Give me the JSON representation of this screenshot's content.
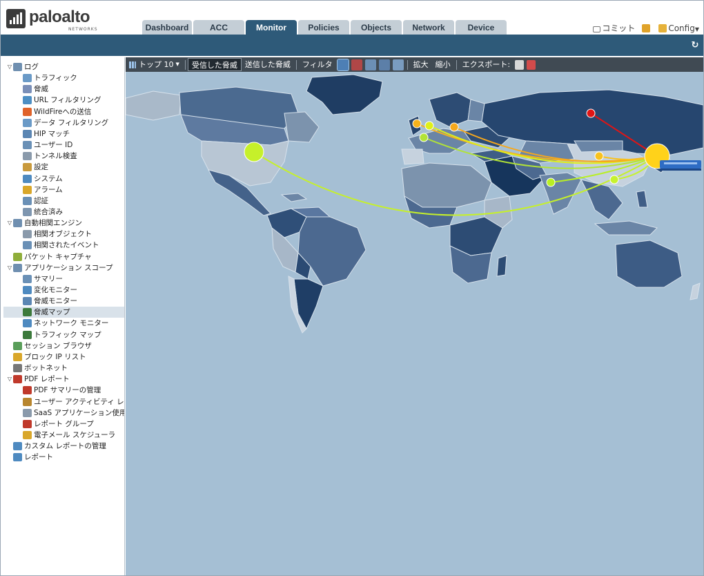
{
  "logo": {
    "word": "paloalto",
    "sub": "NETWORKS"
  },
  "tabs": [
    "Dashboard",
    "ACC",
    "Monitor",
    "Policies",
    "Objects",
    "Network",
    "Device"
  ],
  "active_tab": "Monitor",
  "header_right": {
    "commit": "コミット",
    "config": "Config"
  },
  "toolbar": {
    "top": "トップ 10",
    "received": "受信した脅威",
    "sent": "送信した脅威",
    "filter": "フィルタ",
    "zoom_in": "拡大",
    "zoom_out": "縮小",
    "export": "エクスポート:"
  },
  "sidebar": [
    {
      "label": "ログ",
      "level": 0,
      "expand": "▽",
      "icon": "logs-icon",
      "color": "#6f8fb0"
    },
    {
      "label": "トラフィック",
      "level": 1,
      "icon": "traffic-icon",
      "color": "#6a9ac7"
    },
    {
      "label": "脅威",
      "level": 1,
      "icon": "threat-icon",
      "color": "#7a8fb8"
    },
    {
      "label": "URL フィルタリング",
      "level": 1,
      "icon": "url-icon",
      "color": "#4d8fc4"
    },
    {
      "label": "WildFireへの送信",
      "level": 1,
      "icon": "wildfire-icon",
      "color": "#e0632a"
    },
    {
      "label": "データ フィルタリング",
      "level": 1,
      "icon": "data-filter-icon",
      "color": "#6a9ac7"
    },
    {
      "label": "HIP マッチ",
      "level": 1,
      "icon": "hip-icon",
      "color": "#5b86b3"
    },
    {
      "label": "ユーザー ID",
      "level": 1,
      "icon": "user-id-icon",
      "color": "#6a90b6"
    },
    {
      "label": "トンネル検査",
      "level": 1,
      "icon": "tunnel-icon",
      "color": "#8a9aab"
    },
    {
      "label": "設定",
      "level": 1,
      "icon": "config-log-icon",
      "color": "#c99a3c"
    },
    {
      "label": "システム",
      "level": 1,
      "icon": "system-icon",
      "color": "#4e8ac0"
    },
    {
      "label": "アラーム",
      "level": 1,
      "icon": "alarm-icon",
      "color": "#d9a72a"
    },
    {
      "label": "認証",
      "level": 1,
      "icon": "auth-icon",
      "color": "#6a90b6"
    },
    {
      "label": "統合済み",
      "level": 1,
      "icon": "unified-icon",
      "color": "#7e96b0"
    },
    {
      "label": "自動相関エンジン",
      "level": 0,
      "expand": "▽",
      "icon": "correlation-icon",
      "color": "#6f8fb0"
    },
    {
      "label": "相関オブジェクト",
      "level": 1,
      "icon": "correlation-object-icon",
      "color": "#8a9aab"
    },
    {
      "label": "相関されたイベント",
      "level": 1,
      "icon": "correlated-events-icon",
      "color": "#6a90b6"
    },
    {
      "label": "パケット キャプチャ",
      "level": 0,
      "icon": "packet-capture-icon",
      "color": "#8fae3a"
    },
    {
      "label": "アプリケーション スコープ",
      "level": 0,
      "expand": "▽",
      "icon": "app-scope-icon",
      "color": "#6f8fb0"
    },
    {
      "label": "サマリー",
      "level": 1,
      "icon": "summary-icon",
      "color": "#6a90b6"
    },
    {
      "label": "変化モニター",
      "level": 1,
      "icon": "change-monitor-icon",
      "color": "#4e8ac0"
    },
    {
      "label": "脅威モニター",
      "level": 1,
      "icon": "threat-monitor-icon",
      "color": "#5b86b3"
    },
    {
      "label": "脅威マップ",
      "level": 1,
      "icon": "threat-map-icon",
      "color": "#3c7a3c",
      "selected": true
    },
    {
      "label": "ネットワーク モニター",
      "level": 1,
      "icon": "network-monitor-icon",
      "color": "#4e8ac0"
    },
    {
      "label": "トラフィック マップ",
      "level": 1,
      "icon": "traffic-map-icon",
      "color": "#3c7a3c"
    },
    {
      "label": "セッション ブラウザ",
      "level": 0,
      "icon": "session-browser-icon",
      "color": "#5a9e5a"
    },
    {
      "label": "ブロック IP リスト",
      "level": 0,
      "icon": "block-ip-icon",
      "color": "#d9a72a"
    },
    {
      "label": "ボットネット",
      "level": 0,
      "icon": "botnet-icon",
      "color": "#777777"
    },
    {
      "label": "PDF レポート",
      "level": 0,
      "expand": "▽",
      "icon": "pdf-report-icon",
      "color": "#c0392b"
    },
    {
      "label": "PDF サマリーの管理",
      "level": 1,
      "icon": "pdf-summary-icon",
      "color": "#c0392b"
    },
    {
      "label": "ユーザー アクティビティ レポ",
      "level": 1,
      "icon": "user-activity-icon",
      "color": "#b8862f"
    },
    {
      "label": "SaaS アプリケーション使用率",
      "level": 1,
      "icon": "saas-icon",
      "color": "#8a9aab"
    },
    {
      "label": "レポート グループ",
      "level": 1,
      "icon": "report-group-icon",
      "color": "#c0392b"
    },
    {
      "label": "電子メール スケジューラ",
      "level": 1,
      "icon": "email-scheduler-icon",
      "color": "#d9a72a"
    },
    {
      "label": "カスタム レポートの管理",
      "level": 0,
      "icon": "custom-report-icon",
      "color": "#4e8ac0"
    },
    {
      "label": "レポート",
      "level": 0,
      "icon": "reports-icon",
      "color": "#4e8ac0"
    }
  ],
  "map": {
    "ocean": "#a5bfd4",
    "destination_marker_color": "#ffd21a",
    "sources": [
      {
        "name": "north-america",
        "color": "#c6f02a"
      },
      {
        "name": "western-europe-1",
        "color": "#f6b21c"
      },
      {
        "name": "western-europe-2",
        "color": "#dff019"
      },
      {
        "name": "central-europe",
        "color": "#f6a81c"
      },
      {
        "name": "southern-europe",
        "color": "#b2e336"
      },
      {
        "name": "russia",
        "color": "#e01515"
      },
      {
        "name": "china",
        "color": "#f8c21f"
      },
      {
        "name": "india",
        "color": "#b9ef22"
      },
      {
        "name": "southeast-asia",
        "color": "#c7f22e"
      }
    ]
  }
}
